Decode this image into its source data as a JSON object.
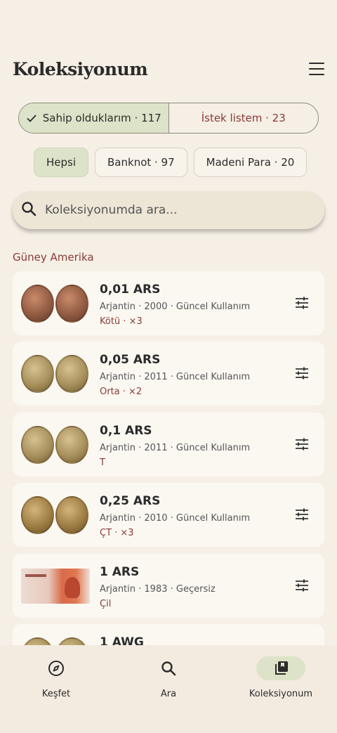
{
  "header": {
    "title": "Koleksiyonum"
  },
  "segments": {
    "owned": "Sahip olduklarım · 117",
    "wishlist": "İstek listem · 23"
  },
  "filters": [
    "Hepsi",
    "Banknot · 97",
    "Madeni Para · 20"
  ],
  "search": {
    "placeholder": "Koleksiyonumda ara..."
  },
  "section": "Güney Amerika",
  "items": [
    {
      "name": "0,01 ARS",
      "meta": "Arjantin · 2000 · Güncel Kullanım",
      "cond": "Kötü · ×3",
      "thumb": "copper-coin"
    },
    {
      "name": "0,05 ARS",
      "meta": "Arjantin · 2011 · Güncel Kullanım",
      "cond": "Orta · ×2",
      "thumb": "brass-coin"
    },
    {
      "name": "0,1 ARS",
      "meta": "Arjantin · 2011 · Güncel Kullanım",
      "cond": "T",
      "thumb": "brass-coin"
    },
    {
      "name": "0,25 ARS",
      "meta": "Arjantin · 2010 · Güncel Kullanım",
      "cond": "ÇT · ×3",
      "thumb": "gold-coin"
    },
    {
      "name": "1 ARS",
      "meta": "Arjantin · 1983 · Geçersiz",
      "cond": "Çil",
      "thumb": "banknote"
    },
    {
      "name": "1 AWG",
      "meta": "",
      "cond": "",
      "thumb": "brass-coin"
    }
  ],
  "nav": {
    "explore": "Keşfet",
    "search": "Ara",
    "collection": "Koleksiyonum"
  },
  "icons": {
    "menu": "hamburger-icon",
    "check": "check-icon",
    "search": "search-icon",
    "tune": "tune-icon",
    "compass": "compass-icon",
    "collection": "library-icon"
  },
  "colors": {
    "background": "#f5efe6",
    "accent": "#dde3c8",
    "condition": "#8a3a34"
  }
}
